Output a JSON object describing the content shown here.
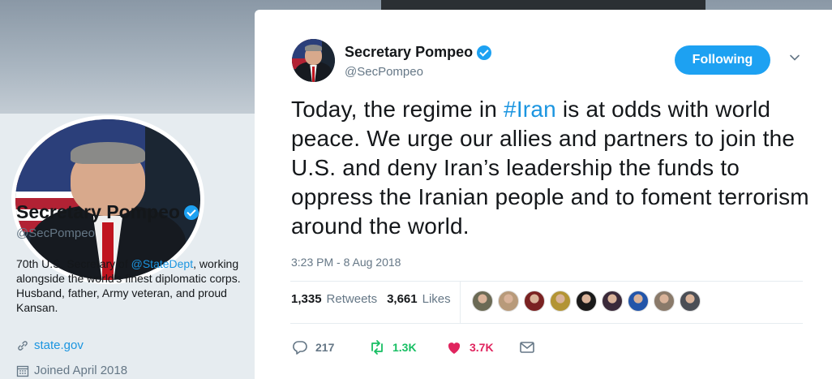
{
  "profile": {
    "name": "Secretary Pompeo",
    "handle": "@SecPompeo",
    "bio_prefix": "70th U.S. Secretary of ",
    "bio_link": "@StateDept",
    "bio_suffix": ", working alongside the world's finest diplomatic corps. Husband, father, Army veteran, and proud Kansan.",
    "url": "state.gov",
    "joined": "Joined April 2018"
  },
  "tweet": {
    "author_name": "Secretary Pompeo",
    "author_handle": "@SecPompeo",
    "follow_label": "Following",
    "text_before": "Today, the regime in ",
    "hashtag": "#Iran",
    "text_after": " is at odds with world peace. We urge our allies and partners to join the U.S. and deny Iran’s leadership the funds to oppress the Iranian people and to foment terrorism around the world.",
    "timestamp": "3:23 PM - 8 Aug 2018",
    "retweets_count": "1,335",
    "retweets_label": "Retweets",
    "likes_count": "3,661",
    "likes_label": "Likes",
    "reply_count": "217",
    "retweet_short": "1.3K",
    "like_short": "3.7K"
  },
  "colors": {
    "accent": "#1da1f2",
    "link": "#1b95e0",
    "retweet_green": "#17bf63",
    "like_red": "#e0245e",
    "muted": "#657786"
  },
  "liker_avatars": [
    "#6b6a55",
    "#b89a7a",
    "#7a2222",
    "#b39434",
    "#1a1a1a",
    "#3a2a3a",
    "#2255aa",
    "#8a7a6a",
    "#4a4e55"
  ]
}
